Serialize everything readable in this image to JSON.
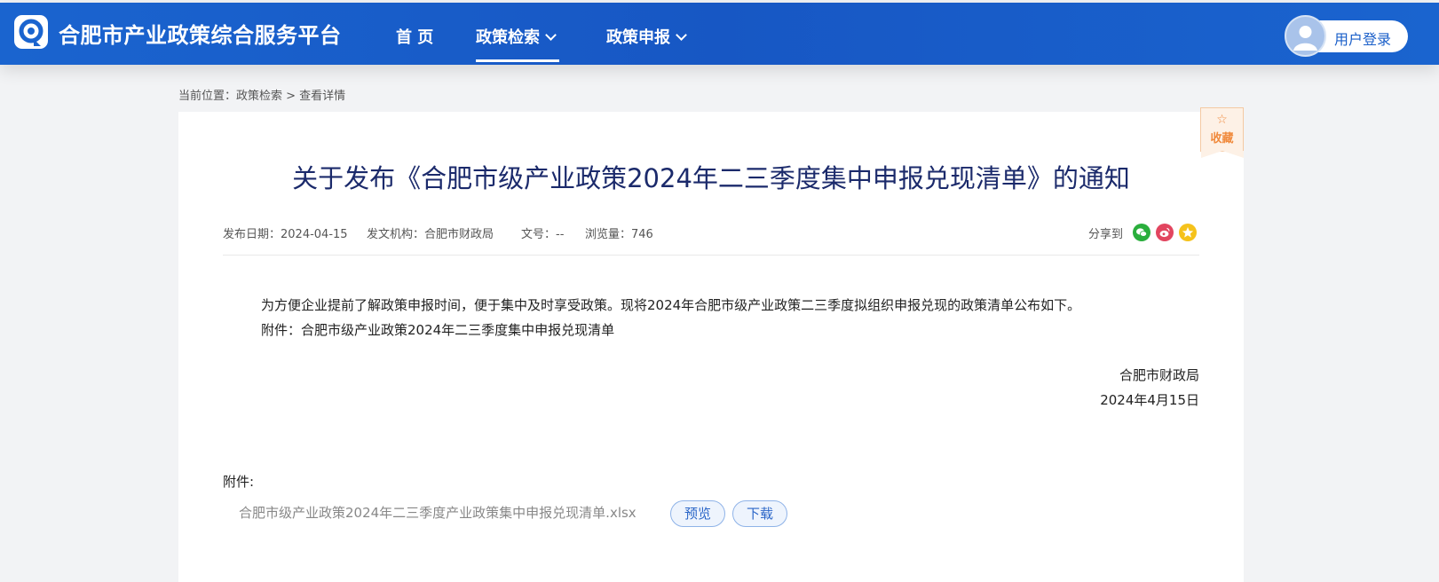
{
  "header": {
    "site_title": "合肥市产业政策综合服务平台",
    "nav": [
      {
        "label": "首 页"
      },
      {
        "label": "政策检索"
      },
      {
        "label": "政策申报"
      }
    ],
    "login_label": "用户登录"
  },
  "breadcrumb": "当前位置：政策检索 > 查看详情",
  "favorite": {
    "label": "收藏",
    "icon": "star-outline-icon"
  },
  "article": {
    "title": "关于发布《合肥市级产业政策2024年二三季度集中申报兑现清单》的通知",
    "meta": {
      "publish_date": "发布日期：2024-04-15",
      "issuer": "发文机构：合肥市财政局",
      "doc_no": "文号：--",
      "views": "浏览量：746"
    },
    "share_label": "分享到",
    "share_icons": [
      "wechat-icon",
      "weibo-icon",
      "qzone-icon"
    ],
    "body": [
      "为方便企业提前了解政策申报时间，便于集中及时享受政策。现将2024年合肥市级产业政策二三季度拟组织申报兑现的政策清单公布如下。",
      "附件：合肥市级产业政策2024年二三季度集中申报兑现清单"
    ],
    "signature": {
      "org": "合肥市财政局",
      "date": "2024年4月15日"
    },
    "attachments_heading": "附件:",
    "attachment": {
      "filename": "合肥市级产业政策2024年二三季度产业政策集中申报兑现清单.xlsx",
      "preview_label": "预览",
      "download_label": "下载"
    }
  },
  "colors": {
    "header_blue": "#1a64cf",
    "title_navy": "#1b2a6b",
    "fav_orange": "#f08a3c",
    "wechat": "#2aae3c",
    "weibo": "#e2455f",
    "qzone": "#f5c21b"
  }
}
